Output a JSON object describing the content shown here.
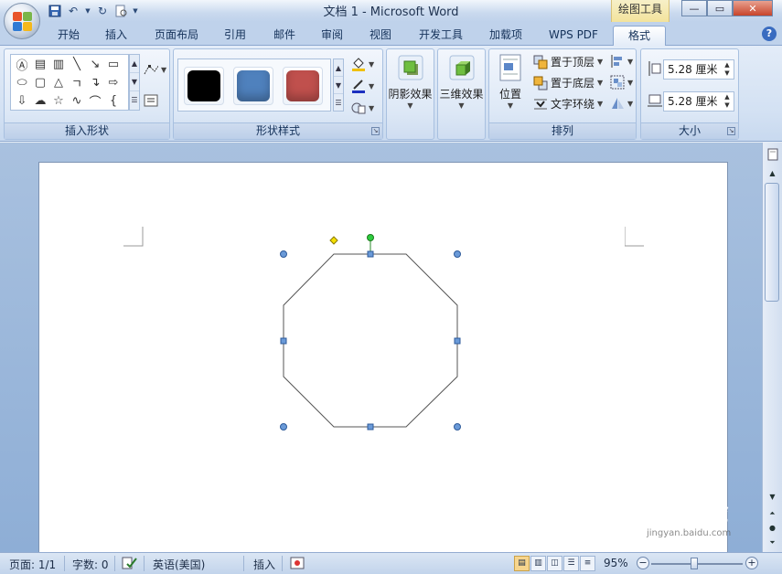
{
  "window": {
    "title": "文档 1 - Microsoft Word",
    "context_tab_title": "绘图工具"
  },
  "tabs": [
    {
      "label": "开始"
    },
    {
      "label": "插入"
    },
    {
      "label": "页面布局"
    },
    {
      "label": "引用"
    },
    {
      "label": "邮件"
    },
    {
      "label": "审阅"
    },
    {
      "label": "视图"
    },
    {
      "label": "开发工具"
    },
    {
      "label": "加载项"
    },
    {
      "label": "WPS PDF"
    },
    {
      "label": "格式"
    }
  ],
  "active_tab": "格式",
  "ribbon": {
    "groups": {
      "insert_shapes": "插入形状",
      "shape_styles": "形状样式",
      "shadow_effects": "阴影效果",
      "threed_effects": "三维效果",
      "arrange": "排列",
      "size": "大小"
    },
    "style_swatches": [
      "#000000",
      "#4f81bd",
      "#c0504d"
    ],
    "arrange": {
      "position": "位置",
      "bring_to_front": "置于顶层",
      "send_to_back": "置于底层",
      "text_wrap": "文字环绕"
    },
    "size": {
      "height": "5.28 厘米",
      "width": "5.28 厘米"
    }
  },
  "statusbar": {
    "page": "页面: 1/1",
    "words": "字数: 0",
    "language": "英语(美国)",
    "mode": "插入",
    "zoom": "95%"
  },
  "watermark": {
    "text": "Baidu经验",
    "sub": "jingyan.baidu.com"
  }
}
